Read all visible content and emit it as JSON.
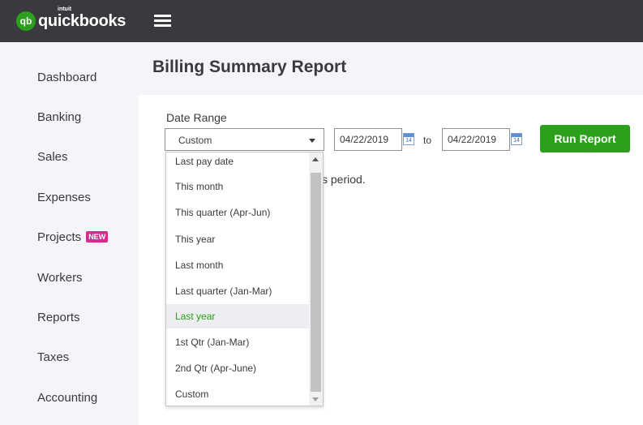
{
  "header": {
    "logo_badge": "qb",
    "logo_small": "intuit",
    "logo_name": "quickbooks",
    "icons": [
      "quickbooks-logo",
      "hamburger-menu-icon"
    ]
  },
  "sidebar": {
    "items": [
      {
        "label": "Dashboard"
      },
      {
        "label": "Banking"
      },
      {
        "label": "Sales"
      },
      {
        "label": "Expenses"
      },
      {
        "label": "Projects",
        "badge": "NEW"
      },
      {
        "label": "Workers"
      },
      {
        "label": "Reports"
      },
      {
        "label": "Taxes"
      },
      {
        "label": "Accounting"
      }
    ]
  },
  "page": {
    "title": "Billing Summary Report"
  },
  "filters": {
    "date_range_label": "Date Range",
    "date_range_value": "Custom",
    "from_date": "04/22/2019",
    "to_label": "to",
    "to_date": "04/22/2019",
    "calendar_day": "14",
    "run_button": "Run Report"
  },
  "body": {
    "period_text": "s period."
  },
  "dropdown": {
    "options": [
      {
        "label": "Last pay date"
      },
      {
        "label": "This month"
      },
      {
        "label": "This quarter (Apr-Jun)"
      },
      {
        "label": "This year"
      },
      {
        "label": "Last month"
      },
      {
        "label": "Last quarter (Jan-Mar)"
      },
      {
        "label": "Last year",
        "highlighted": true
      },
      {
        "label": "1st Qtr (Jan-Mar)"
      },
      {
        "label": "2nd Qtr (Apr-June)"
      },
      {
        "label": "Custom"
      }
    ]
  },
  "colors": {
    "brand_green": "#2ca01c",
    "topbar": "#393a3d",
    "new_badge": "#d52b8f"
  }
}
